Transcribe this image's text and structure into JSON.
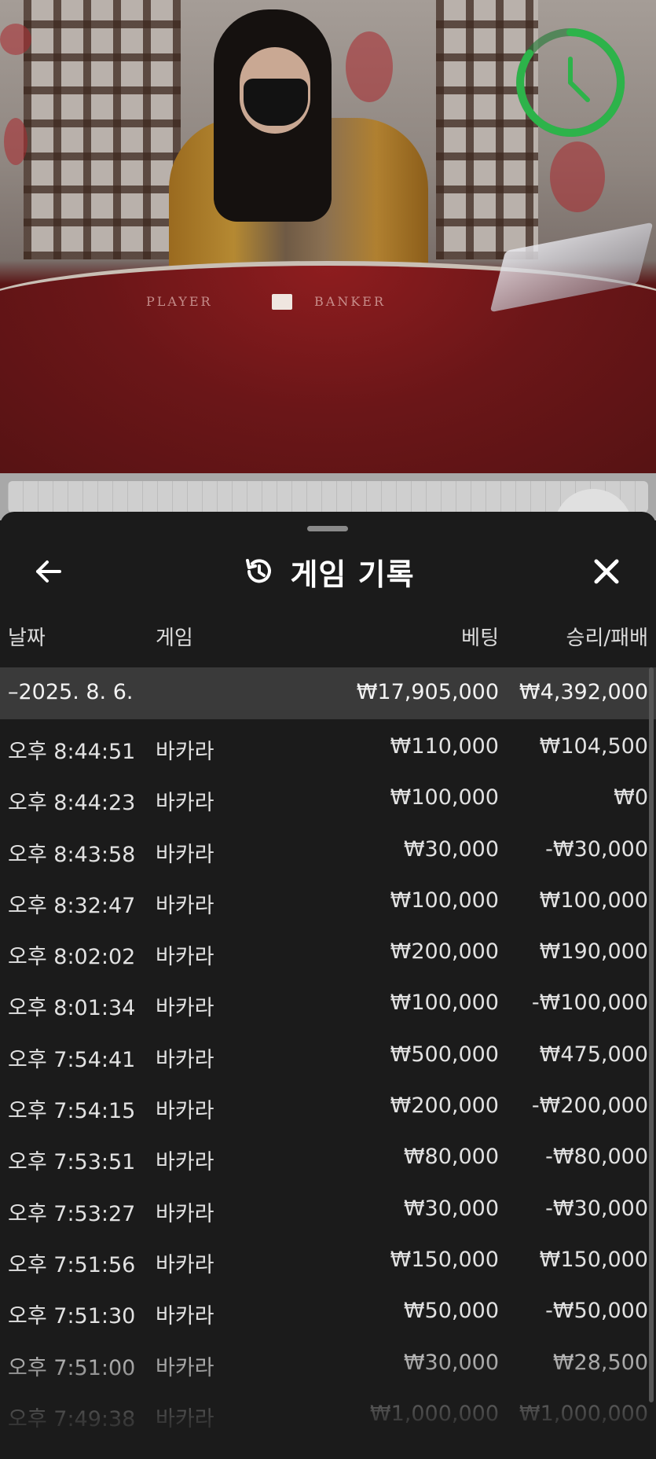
{
  "header": {
    "title": "게임 기록",
    "back_icon": "arrow-left-icon",
    "history_icon": "history-icon",
    "close_icon": "close-icon"
  },
  "video": {
    "table_left_label": "PLAYER",
    "table_right_label": "BANKER",
    "timer_icon": "clock-icon",
    "timer_color": "#2db34a"
  },
  "columns": {
    "date": "날짜",
    "game": "게임",
    "bet": "베팅",
    "win_loss": "승리/패배"
  },
  "group": {
    "date": "–2025. 8. 6.",
    "bet_total": "₩17,905,000",
    "win_total": "₩4,392,000"
  },
  "rows": [
    {
      "time": "오후 8:44:51",
      "game": "바카라",
      "bet": "₩110,000",
      "result": "₩104,500"
    },
    {
      "time": "오후 8:44:23",
      "game": "바카라",
      "bet": "₩100,000",
      "result": "₩0"
    },
    {
      "time": "오후 8:43:58",
      "game": "바카라",
      "bet": "₩30,000",
      "result": "-₩30,000"
    },
    {
      "time": "오후 8:32:47",
      "game": "바카라",
      "bet": "₩100,000",
      "result": "₩100,000"
    },
    {
      "time": "오후 8:02:02",
      "game": "바카라",
      "bet": "₩200,000",
      "result": "₩190,000"
    },
    {
      "time": "오후 8:01:34",
      "game": "바카라",
      "bet": "₩100,000",
      "result": "-₩100,000"
    },
    {
      "time": "오후 7:54:41",
      "game": "바카라",
      "bet": "₩500,000",
      "result": "₩475,000"
    },
    {
      "time": "오후 7:54:15",
      "game": "바카라",
      "bet": "₩200,000",
      "result": "-₩200,000"
    },
    {
      "time": "오후 7:53:51",
      "game": "바카라",
      "bet": "₩80,000",
      "result": "-₩80,000"
    },
    {
      "time": "오후 7:53:27",
      "game": "바카라",
      "bet": "₩30,000",
      "result": "-₩30,000"
    },
    {
      "time": "오후 7:51:56",
      "game": "바카라",
      "bet": "₩150,000",
      "result": "₩150,000"
    },
    {
      "time": "오후 7:51:30",
      "game": "바카라",
      "bet": "₩50,000",
      "result": "-₩50,000"
    },
    {
      "time": "오후 7:51:00",
      "game": "바카라",
      "bet": "₩30,000",
      "result": "₩28,500"
    },
    {
      "time": "오후 7:49:38",
      "game": "바카라",
      "bet": "₩1,000,000",
      "result": "₩1,000,000"
    }
  ]
}
